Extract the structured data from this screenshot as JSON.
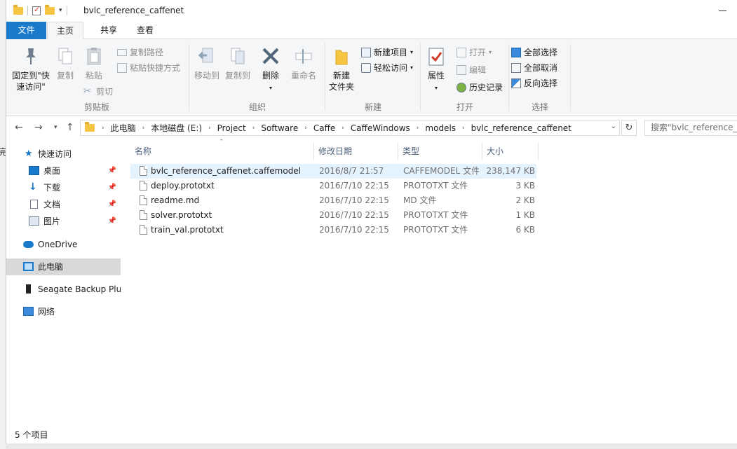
{
  "window": {
    "title": "bvlc_reference_caffenet"
  },
  "sidebar_fragment": "完",
  "tabs": [
    {
      "label": "文件"
    },
    {
      "label": "主页"
    },
    {
      "label": "共享"
    },
    {
      "label": "查看"
    }
  ],
  "ribbon": {
    "clipboard": {
      "label": "剪贴板",
      "pin": "固定到\"快\n速访问\"",
      "pin_l1": "固定到\"快",
      "pin_l2": "速访问\"",
      "copy": "复制",
      "paste": "粘贴",
      "copy_path": "复制路径",
      "paste_shortcut": "粘贴快捷方式",
      "cut": "剪切"
    },
    "organize": {
      "label": "组织",
      "move_to": "移动到",
      "copy_to": "复制到",
      "delete": "删除",
      "rename": "重命名"
    },
    "new": {
      "label": "新建",
      "new_folder_l1": "新建",
      "new_folder_l2": "文件夹",
      "new_item": "新建项目",
      "easy_access": "轻松访问"
    },
    "open": {
      "label": "打开",
      "properties": "属性",
      "open": "打开",
      "edit": "编辑",
      "history": "历史记录"
    },
    "select": {
      "label": "选择",
      "select_all": "全部选择",
      "select_none": "全部取消",
      "invert": "反向选择"
    }
  },
  "address": {
    "crumbs": [
      "此电脑",
      "本地磁盘 (E:)",
      "Project",
      "Software",
      "Caffe",
      "CaffeWindows",
      "models",
      "bvlc_reference_caffenet"
    ],
    "search_placeholder": "搜索\"bvlc_reference_caffenet\""
  },
  "nav": {
    "quick_access": "快速访问",
    "desktop": "桌面",
    "downloads": "下载",
    "documents": "文档",
    "pictures": "图片",
    "onedrive": "OneDrive",
    "this_pc": "此电脑",
    "seagate": "Seagate Backup Plus",
    "network": "网络"
  },
  "columns": {
    "name": "名称",
    "modified": "修改日期",
    "type": "类型",
    "size": "大小"
  },
  "files": [
    {
      "name": "bvlc_reference_caffenet.caffemodel",
      "modified": "2016/8/7 21:57",
      "type": "CAFFEMODEL 文件",
      "size": "238,147 KB"
    },
    {
      "name": "deploy.prototxt",
      "modified": "2016/7/10 22:15",
      "type": "PROTOTXT 文件",
      "size": "3 KB"
    },
    {
      "name": "readme.md",
      "modified": "2016/7/10 22:15",
      "type": "MD 文件",
      "size": "2 KB"
    },
    {
      "name": "solver.prototxt",
      "modified": "2016/7/10 22:15",
      "type": "PROTOTXT 文件",
      "size": "1 KB"
    },
    {
      "name": "train_val.prototxt",
      "modified": "2016/7/10 22:15",
      "type": "PROTOTXT 文件",
      "size": "6 KB"
    }
  ],
  "status": {
    "count": "5 个项目"
  },
  "colors": {
    "accent": "#1979ca",
    "selection": "#e5f3ff",
    "nav_selected": "#d9d9d9"
  }
}
